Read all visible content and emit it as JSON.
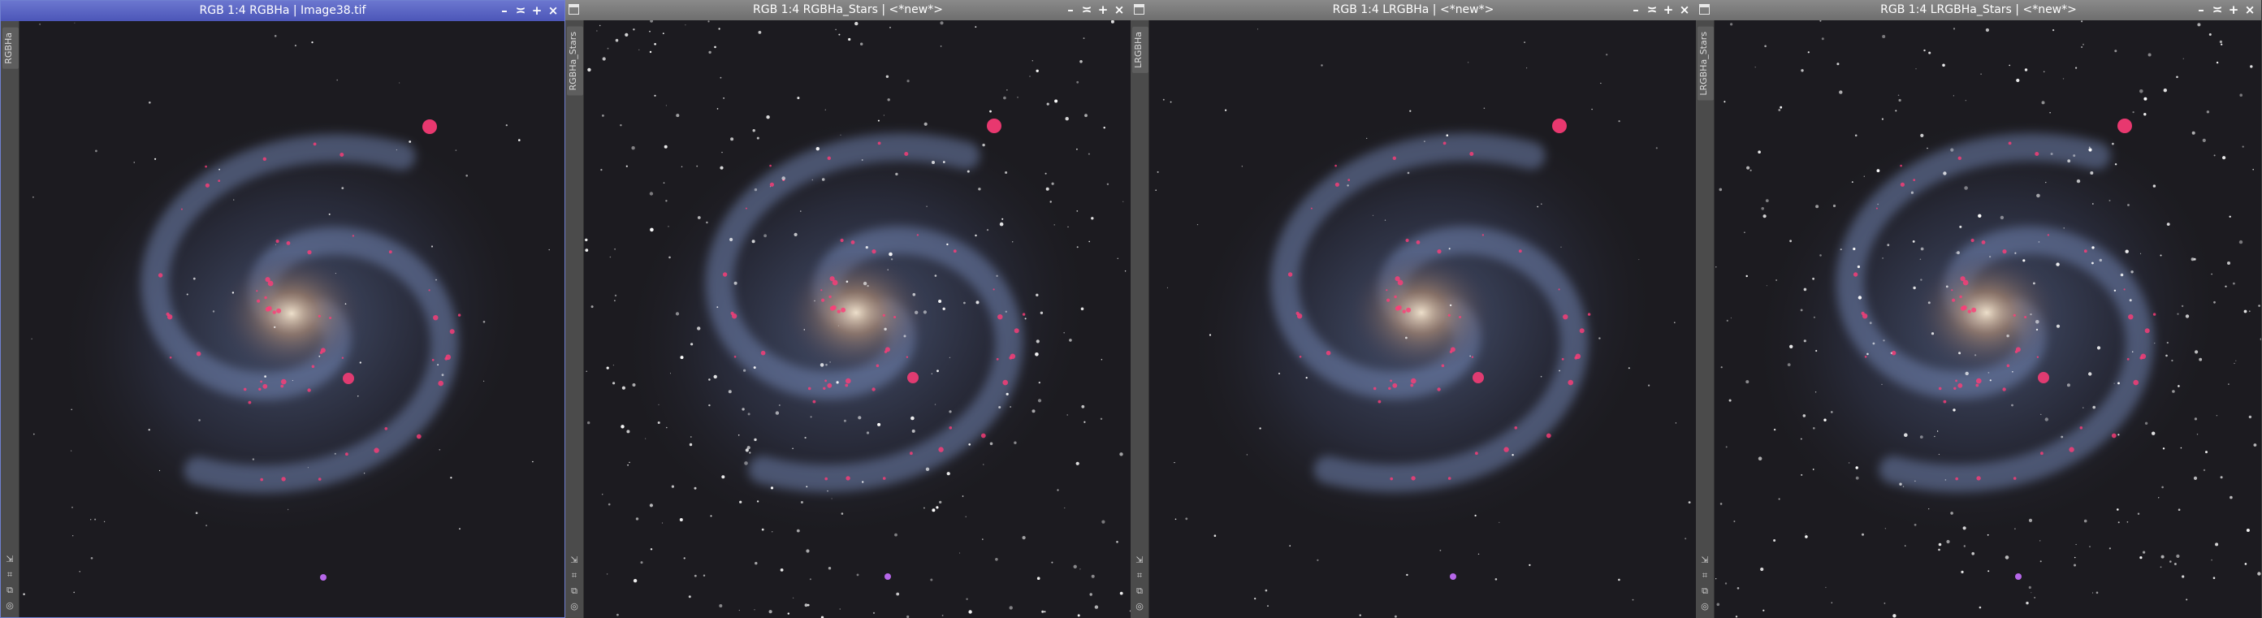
{
  "windows": [
    {
      "title": "RGB 1:4 RGBHa | Image38.tif",
      "tab_label": "RGBHa",
      "active": true,
      "stars": false
    },
    {
      "title": "RGB 1:4 RGBHa_Stars | <*new*>",
      "tab_label": "RGBHa_Stars",
      "active": false,
      "stars": true
    },
    {
      "title": "RGB 1:4 LRGBHa | <*new*>",
      "tab_label": "LRGBHa",
      "active": false,
      "stars": false
    },
    {
      "title": "RGB 1:4 LRGBHa_Stars | <*new*>",
      "tab_label": "LRGBHa_Stars",
      "active": false,
      "stars": true
    }
  ],
  "controls": {
    "minimize": "–",
    "shade": "≍",
    "maximize": "+",
    "close": "×"
  },
  "tools": [
    "⇲",
    "⌗",
    "⧉",
    "◎"
  ],
  "colors": {
    "active_title": "#5560c4",
    "inactive_title": "#7a7a7a",
    "background": "#1c1b20",
    "core": "#f5e6cf",
    "arm": "#6f86b8",
    "ha_region": "#ff3c78"
  }
}
